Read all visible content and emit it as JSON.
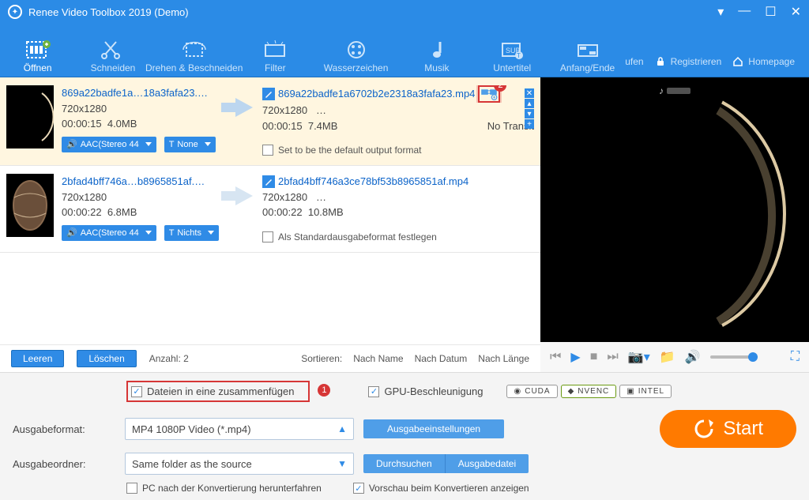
{
  "title": "Renee Video Toolbox 2019 (Demo)",
  "toolbar": [
    {
      "label": "Öffnen"
    },
    {
      "label": "Schneiden"
    },
    {
      "label": "Drehen & Beschneiden"
    },
    {
      "label": "Filter"
    },
    {
      "label": "Wasserzeichen"
    },
    {
      "label": "Musik"
    },
    {
      "label": "Untertitel"
    },
    {
      "label": "Anfang/Ende"
    }
  ],
  "header_actions": {
    "buy": "ufen",
    "register": "Registrieren",
    "home": "Homepage"
  },
  "files": [
    {
      "src_name": "869a22badfe1a…18a3fafa23.mp4",
      "src_res": "720x1280",
      "src_time": "00:00:15",
      "src_size": "4.0MB",
      "audio_pill": "AAC(Stereo 44",
      "subtitle_pill": "None",
      "out_name": "869a22badfe1a6702b2e2318a3fafa23.mp4",
      "out_res": "720x1280",
      "out_more": "…",
      "out_time": "00:00:15",
      "out_size": "7.4MB",
      "transition": "No Transit",
      "default_label": "Set to be the default output format",
      "badge": "2"
    },
    {
      "src_name": "2bfad4bff746a…b8965851af.mp4",
      "src_res": "720x1280",
      "src_time": "00:00:22",
      "src_size": "6.8MB",
      "audio_pill": "AAC(Stereo 44",
      "subtitle_pill": "Nichts",
      "out_name": "2bfad4bff746a3ce78bf53b8965851af.mp4",
      "out_res": "720x1280",
      "out_more": "…",
      "out_time": "00:00:22",
      "out_size": "10.8MB",
      "default_label": "Als Standardausgabeformat festlegen"
    }
  ],
  "footer": {
    "clear": "Leeren",
    "delete": "Löschen",
    "count_label": "Anzahl:",
    "count": "2",
    "sort_label": "Sortieren:",
    "sort_name": "Nach Name",
    "sort_date": "Nach Datum",
    "sort_length": "Nach Länge"
  },
  "bottom": {
    "merge": "Dateien in eine zusammenfügen",
    "merge_badge": "1",
    "gpu": "GPU-Beschleunigung",
    "gpu_tags": [
      "CUDA",
      "NVENC",
      "INTEL"
    ],
    "fmt_label": "Ausgabeformat:",
    "fmt_value": "MP4 1080P Video (*.mp4)",
    "settings": "Ausgabeeinstellungen",
    "folder_label": "Ausgabeordner:",
    "folder_value": "Same folder as the source",
    "browse": "Durchsuchen",
    "output_file": "Ausgabedatei",
    "shutdown": "PC nach der Konvertierung herunterfahren",
    "preview_conv": "Vorschau beim Konvertieren anzeigen",
    "start": "Start"
  },
  "t_icon": "T",
  "speaker_glyph": "🔊"
}
